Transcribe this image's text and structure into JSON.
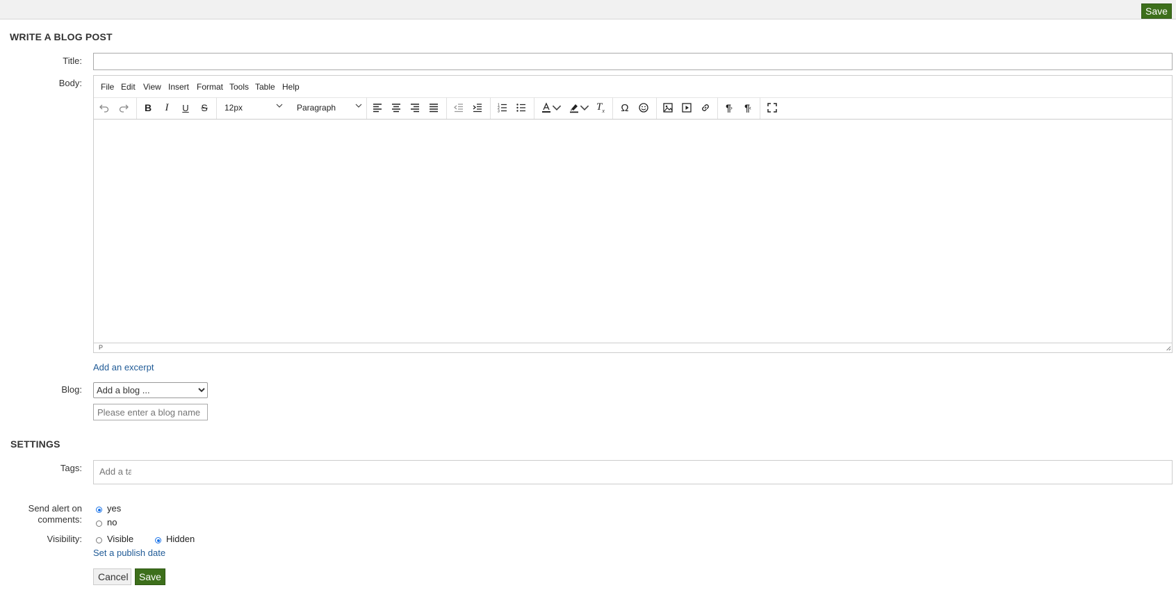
{
  "header": {
    "save_label": "Save"
  },
  "form": {
    "heading": "WRITE A BLOG POST",
    "title_label": "Title:",
    "title_value": "",
    "body_label": "Body:",
    "editor": {
      "menu": [
        "File",
        "Edit",
        "View",
        "Insert",
        "Format",
        "Tools",
        "Table",
        "Help"
      ],
      "font_size": "12px",
      "block_format": "Paragraph",
      "status_path": "P",
      "tools": [
        "undo-icon",
        "redo-icon",
        "bold-icon",
        "italic-icon",
        "underline-icon",
        "strikethrough-icon",
        "align-left-icon",
        "align-center-icon",
        "align-right-icon",
        "align-justify-icon",
        "outdent-icon",
        "indent-icon",
        "numbered-list-icon",
        "bullet-list-icon",
        "text-color-icon",
        "highlight-icon",
        "clear-formatting-icon",
        "special-character-icon",
        "emoticon-icon",
        "image-icon",
        "media-icon",
        "link-icon",
        "ltr-icon",
        "rtl-icon",
        "fullscreen-icon"
      ]
    },
    "excerpt_link": "Add an excerpt",
    "blog_label": "Blog:",
    "blog_select": "Add a blog ...",
    "blog_name_placeholder": "Please enter a blog name"
  },
  "settings": {
    "heading": "SETTINGS",
    "tags_label": "Tags:",
    "tags_placeholder": "Add a ta",
    "alert_label_line1": "Send alert on",
    "alert_label_line2": "comments:",
    "alert_yes": "yes",
    "alert_no": "no",
    "alert_selected": "yes",
    "visibility_label": "Visibility:",
    "visibility_visible": "Visible",
    "visibility_hidden": "Hidden",
    "visibility_selected": "Hidden",
    "publish_link": "Set a publish date"
  },
  "footer": {
    "cancel_label": "Cancel",
    "save_label": "Save"
  },
  "colors": {
    "save_green": "#3d6f1b",
    "link_blue": "#1f5a96",
    "radio_blue": "#1a73e8"
  }
}
